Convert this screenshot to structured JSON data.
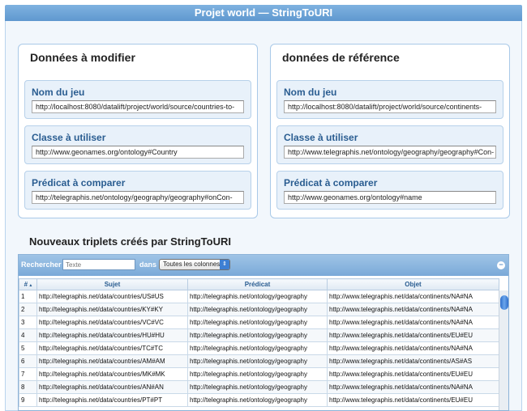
{
  "window": {
    "title": "Projet world — StringToURI"
  },
  "left_panel": {
    "title": "Données à modifier",
    "fields": [
      {
        "label": "Nom du jeu",
        "value": "http://localhost:8080/datalift/project/world/source/countries-to-"
      },
      {
        "label": "Classe à utiliser",
        "value": "http://www.geonames.org/ontology#Country"
      },
      {
        "label": "Prédicat à comparer",
        "value": "http://telegraphis.net/ontology/geography/geography#onCon-"
      }
    ]
  },
  "right_panel": {
    "title": "données de référence",
    "fields": [
      {
        "label": "Nom du jeu",
        "value": "http://localhost:8080/datalift/project/world/source/continents-"
      },
      {
        "label": "Classe à utiliser",
        "value": "http://www.telegraphis.net/ontology/geography/geography#Con-"
      },
      {
        "label": "Prédicat à comparer",
        "value": "http://www.geonames.org/ontology#name"
      }
    ]
  },
  "results": {
    "title": "Nouveaux triplets créés par StringToURI",
    "toolbar": {
      "search_label": "Rechercher",
      "search_placeholder": "Texte",
      "in_label": "dans",
      "column_select": "Toutes les colonnes"
    },
    "columns": [
      "#",
      "Sujet",
      "Prédicat",
      "Objet"
    ],
    "rows": [
      [
        "1",
        "http://telegraphis.net/data/countries/US#US",
        "http://telegraphis.net/ontology/geography",
        "http://www.telegraphis.net/data/continents/NA#NA"
      ],
      [
        "2",
        "http://telegraphis.net/data/countries/KY#KY",
        "http://telegraphis.net/ontology/geography",
        "http://www.telegraphis.net/data/continents/NA#NA"
      ],
      [
        "3",
        "http://telegraphis.net/data/countries/VC#VC",
        "http://telegraphis.net/ontology/geography",
        "http://www.telegraphis.net/data/continents/NA#NA"
      ],
      [
        "4",
        "http://telegraphis.net/data/countries/HU#HU",
        "http://telegraphis.net/ontology/geography",
        "http://www.telegraphis.net/data/continents/EU#EU"
      ],
      [
        "5",
        "http://telegraphis.net/data/countries/TC#TC",
        "http://telegraphis.net/ontology/geography",
        "http://www.telegraphis.net/data/continents/NA#NA"
      ],
      [
        "6",
        "http://telegraphis.net/data/countries/AM#AM",
        "http://telegraphis.net/ontology/geography",
        "http://www.telegraphis.net/data/continents/AS#AS"
      ],
      [
        "7",
        "http://telegraphis.net/data/countries/MK#MK",
        "http://telegraphis.net/ontology/geography",
        "http://www.telegraphis.net/data/continents/EU#EU"
      ],
      [
        "8",
        "http://telegraphis.net/data/countries/AN#AN",
        "http://telegraphis.net/ontology/geography",
        "http://www.telegraphis.net/data/continents/NA#NA"
      ],
      [
        "9",
        "http://telegraphis.net/data/countries/PT#PT",
        "http://telegraphis.net/ontology/geography",
        "http://www.telegraphis.net/data/continents/EU#EU"
      ]
    ]
  }
}
